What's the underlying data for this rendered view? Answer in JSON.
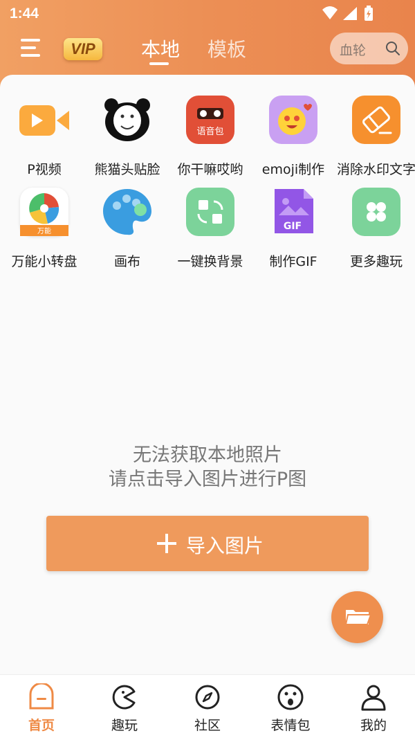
{
  "status_bar": {
    "time": "1:44"
  },
  "header": {
    "vip_label": "VIP",
    "tabs": [
      {
        "label": "本地",
        "active": true
      },
      {
        "label": "模板",
        "active": false
      }
    ],
    "search": {
      "placeholder": "血轮"
    }
  },
  "tools": [
    {
      "label": "P视频",
      "icon": "video-icon"
    },
    {
      "label": "熊猫头贴脸",
      "icon": "panda-face-icon"
    },
    {
      "label": "你干嘛哎哟",
      "icon": "voice-pack-icon",
      "badge": "语音包"
    },
    {
      "label": "emoji制作",
      "icon": "emoji-icon"
    },
    {
      "label": "消除水印文字",
      "icon": "eraser-icon"
    },
    {
      "label": "万能小转盘",
      "icon": "wheel-icon",
      "badge": "万能"
    },
    {
      "label": "画布",
      "icon": "palette-icon"
    },
    {
      "label": "一键换背景",
      "icon": "swap-background-icon"
    },
    {
      "label": "制作GIF",
      "icon": "gif-icon",
      "badge": "GIF"
    },
    {
      "label": "更多趣玩",
      "icon": "more-icon"
    }
  ],
  "empty_state": {
    "line1": "无法获取本地照片",
    "line2": "请点击导入图片进行P图"
  },
  "import_button": {
    "label": "导入图片"
  },
  "bottom_nav": [
    {
      "label": "首页",
      "icon": "home-icon",
      "active": true
    },
    {
      "label": "趣玩",
      "icon": "fun-icon",
      "active": false
    },
    {
      "label": "社区",
      "icon": "compass-icon",
      "active": false
    },
    {
      "label": "表情包",
      "icon": "surprised-face-icon",
      "active": false
    },
    {
      "label": "我的",
      "icon": "profile-icon",
      "active": false
    }
  ],
  "colors": {
    "accent": "#ef8a45",
    "header_start": "#f1a063",
    "header_end": "#e9844c",
    "import_button": "#ef9a5c"
  }
}
